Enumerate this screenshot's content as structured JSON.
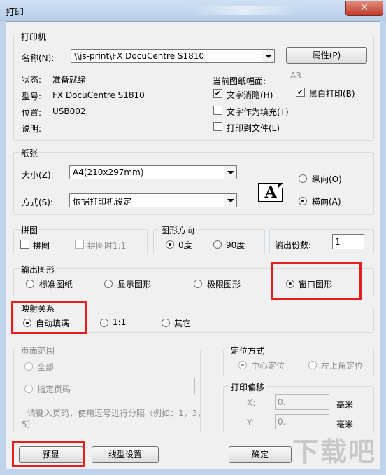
{
  "window": {
    "title": "打印",
    "close_glyph": "✕"
  },
  "printer": {
    "group_title": "打印机",
    "name_label": "名称(N):",
    "name_value": "\\\\js-print\\FX DocuCentre S1810",
    "properties_button": "属性(P)",
    "status_label": "状态:",
    "status_value": "准备就绪",
    "type_label": "型号:",
    "type_value": "FX DocuCentre S1810",
    "location_label": "位置:",
    "location_value": "USB002",
    "comment_label": "说明:",
    "paper_size_label": "当前图纸幅面:",
    "paper_size_value": "A3",
    "text_hide": {
      "label": "文字消隐(H)",
      "checked": true
    },
    "bw_print": {
      "label": "黑白打印(B)",
      "checked": true
    },
    "text_fill": {
      "label": "文字作为填充(T)",
      "checked": false
    },
    "print_to_file": {
      "label": "打印到文件(L)",
      "checked": false
    }
  },
  "paper": {
    "group_title": "纸张",
    "size_label": "大小(Z):",
    "size_value": "A4(210x297mm)",
    "method_label": "方式(S):",
    "method_value": "依据打印机设定",
    "preview_glyph": "A",
    "portrait": {
      "label": "纵向(O)",
      "selected": false
    },
    "landscape": {
      "label": "横向(A)",
      "selected": true
    }
  },
  "tile": {
    "group_title": "拼图",
    "tile_label": "拼图",
    "tile_1to1_label": "拼图时1:1"
  },
  "orientation": {
    "group_title": "图形方向",
    "deg0": "0度",
    "deg90": "90度",
    "selected": "0度"
  },
  "copies": {
    "label": "输出份数:",
    "value": "1"
  },
  "output": {
    "group_title": "输出图形",
    "options": [
      "标准图纸",
      "显示图形",
      "极限图形",
      "窗口图形"
    ],
    "selected": "窗口图形"
  },
  "mapping": {
    "group_title": "映射关系",
    "options": [
      "自动填满",
      "1:1",
      "其它"
    ],
    "selected": "自动填满"
  },
  "page_range": {
    "group_title": "页面范围",
    "all_label": "全部",
    "specify_label": "指定页码",
    "hint_line1": "请键入页码，使用逗号进行分隔（例如：1，3，",
    "hint_line2": "5）"
  },
  "position": {
    "group_title": "定位方式",
    "center": "中心定位",
    "topleft": "左上角定位"
  },
  "offset": {
    "group_title": "打印偏移",
    "x_label": "X:",
    "x_value": "0.",
    "y_label": "Y:",
    "y_value": "0.",
    "unit": "毫米"
  },
  "buttons": {
    "preview": "预显",
    "linetype": "线型设置",
    "ok": "确定"
  },
  "watermark": "下载吧"
}
